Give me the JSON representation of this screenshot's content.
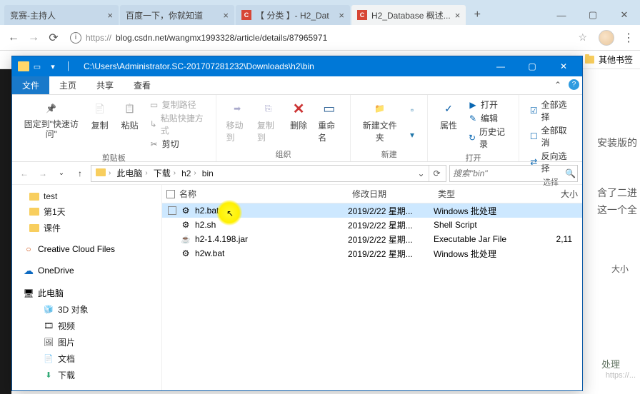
{
  "browser": {
    "tabs": [
      {
        "title": "竞赛-主持人",
        "favicon": "blank"
      },
      {
        "title": "百度一下，你就知道",
        "favicon": "baidu"
      },
      {
        "title": "【 分类 】- H2_Dat",
        "favicon": "csdn"
      },
      {
        "title": "H2_Database 概述...",
        "favicon": "csdn",
        "active": true
      }
    ],
    "nav": {
      "back": "←",
      "forward": "→",
      "reload": "⟳"
    },
    "url_scheme": "https://",
    "url_rest": "blog.csdn.net/wangmx1993328/article/details/87965971",
    "bookmark_folder": "其他书签"
  },
  "page_behind": {
    "line1": "安装版的",
    "line2_a": "含了二进",
    "line2_b": "这一个全",
    "line3": "大小",
    "line4": "处理",
    "line5": "https://..."
  },
  "explorer": {
    "titlebar_path": "C:\\Users\\Administrator.SC-201707281232\\Downloads\\h2\\bin",
    "tabs": {
      "file": "文件",
      "home": "主页",
      "share": "共享",
      "view": "查看"
    },
    "ribbon": {
      "clipboard": {
        "group": "剪贴板",
        "pin": "固定到\"快速访问\"",
        "copy": "复制",
        "paste": "粘贴",
        "cut": "剪切",
        "copy_path": "复制路径",
        "paste_shortcut": "粘贴快捷方式"
      },
      "organize": {
        "group": "组织",
        "moveto": "移动到",
        "copyto": "复制到",
        "delete": "删除",
        "rename": "重命名"
      },
      "new": {
        "group": "新建",
        "newfolder": "新建文件夹"
      },
      "open": {
        "group": "打开",
        "properties": "属性",
        "open": "打开",
        "edit": "编辑",
        "history": "历史记录"
      },
      "select": {
        "group": "选择",
        "all": "全部选择",
        "none": "全部取消",
        "invert": "反向选择"
      }
    },
    "breadcrumb": [
      "此电脑",
      "下载",
      "h2",
      "bin"
    ],
    "search_placeholder": "搜索\"bin\"",
    "navpane": {
      "test": "test",
      "day1": "第1天",
      "courseware": "课件",
      "creative": "Creative Cloud Files",
      "onedrive": "OneDrive",
      "thispc": "此电脑",
      "obj3d": "3D 对象",
      "video": "视频",
      "pictures": "图片",
      "documents": "文档",
      "downloads": "下载"
    },
    "columns": {
      "name": "名称",
      "date": "修改日期",
      "type": "类型",
      "size": "大小"
    },
    "files": [
      {
        "name": "h2.bat",
        "date": "2019/2/22 星期...",
        "type": "Windows 批处理",
        "size": "",
        "icon": "gear",
        "selected": true
      },
      {
        "name": "h2.sh",
        "date": "2019/2/22 星期...",
        "type": "Shell Script",
        "size": "",
        "icon": "gear"
      },
      {
        "name": "h2-1.4.198.jar",
        "date": "2019/2/22 星期...",
        "type": "Executable Jar File",
        "size": "2,11",
        "icon": "jar"
      },
      {
        "name": "h2w.bat",
        "date": "2019/2/22 星期...",
        "type": "Windows 批处理",
        "size": "",
        "icon": "gear"
      }
    ]
  }
}
